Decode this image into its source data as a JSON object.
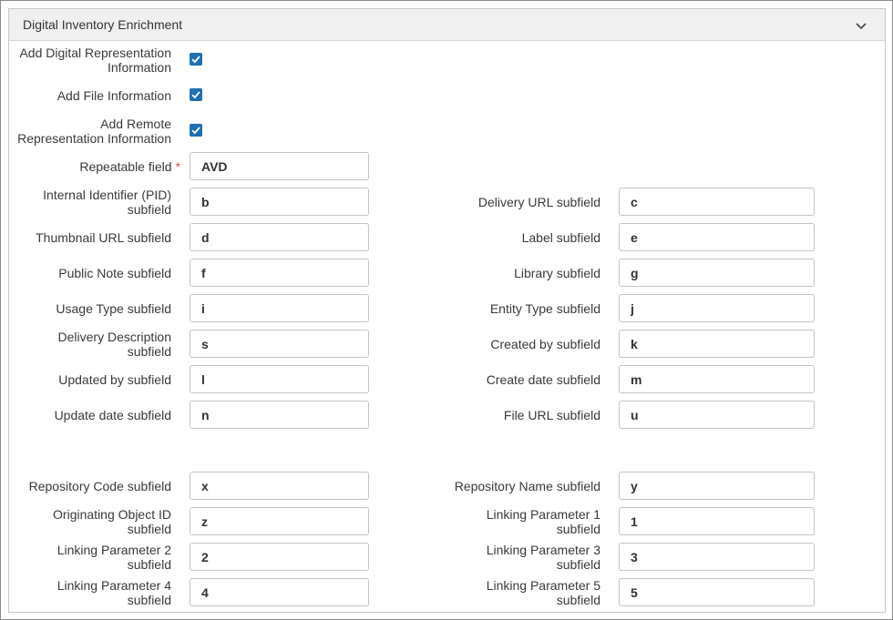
{
  "panel": {
    "title": "Digital Inventory Enrichment"
  },
  "checkboxes": [
    {
      "line1": "Add Digital Representation",
      "line2": "Information",
      "checked": true
    },
    {
      "line1": "Add File Information",
      "line2": "",
      "checked": true
    },
    {
      "line1": "Add Remote",
      "line2": "Representation Information",
      "checked": true
    }
  ],
  "repeatable": {
    "label": "Repeatable field",
    "required_marker": "*",
    "value": "AVD"
  },
  "left_fields": [
    {
      "line1": "Internal Identifier (PID)",
      "line2": "subfield",
      "value": "b"
    },
    {
      "line1": "Thumbnail URL subfield",
      "line2": "",
      "value": "d"
    },
    {
      "line1": "Public Note subfield",
      "line2": "",
      "value": "f"
    },
    {
      "line1": "Usage Type subfield",
      "line2": "",
      "value": "i"
    },
    {
      "line1": "Delivery Description",
      "line2": "subfield",
      "value": "s"
    },
    {
      "line1": "Updated by subfield",
      "line2": "",
      "value": "l"
    },
    {
      "line1": "Update date subfield",
      "line2": "",
      "value": "n"
    },
    {
      "line1": "Repository Code subfield",
      "line2": "",
      "value": "x"
    },
    {
      "line1": "Originating Object ID",
      "line2": "subfield",
      "value": "z"
    },
    {
      "line1": "Linking Parameter 2",
      "line2": "subfield",
      "value": "2"
    },
    {
      "line1": "Linking Parameter 4",
      "line2": "subfield",
      "value": "4"
    }
  ],
  "right_fields": [
    {
      "line1": "Delivery URL subfield",
      "line2": "",
      "value": "c"
    },
    {
      "line1": "Label subfield",
      "line2": "",
      "value": "e"
    },
    {
      "line1": "Library subfield",
      "line2": "",
      "value": "g"
    },
    {
      "line1": "Entity Type subfield",
      "line2": "",
      "value": "j"
    },
    {
      "line1": "Created by subfield",
      "line2": "",
      "value": "k"
    },
    {
      "line1": "Create date subfield",
      "line2": "",
      "value": "m"
    },
    {
      "line1": "File URL subfield",
      "line2": "",
      "value": "u"
    },
    {
      "line1": "Repository Name subfield",
      "line2": "",
      "value": "y"
    },
    {
      "line1": "Linking Parameter 1",
      "line2": "subfield",
      "value": "1"
    },
    {
      "line1": "Linking Parameter 3",
      "line2": "subfield",
      "value": "3"
    },
    {
      "line1": "Linking Parameter 5",
      "line2": "subfield",
      "value": "5"
    }
  ],
  "colors": {
    "accent": "#1f6fb2",
    "required": "#d9534f",
    "header_bg": "#f0f0f0"
  },
  "icons": {
    "collapse": "chevron-down-icon",
    "checkbox": "checkmark-icon"
  }
}
